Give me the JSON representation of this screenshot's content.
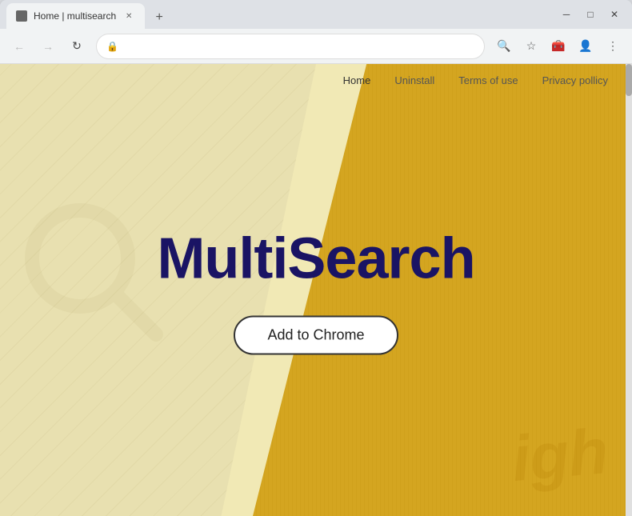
{
  "browser": {
    "tab": {
      "title": "Home | multisearch",
      "favicon": "🔍"
    },
    "new_tab_label": "+",
    "window_controls": {
      "minimize": "─",
      "maximize": "□",
      "close": "✕"
    },
    "address_bar": {
      "url": "",
      "lock_icon": "🔒"
    }
  },
  "site": {
    "nav": {
      "items": [
        {
          "label": "Home",
          "active": true
        },
        {
          "label": "Uninstall",
          "active": false
        },
        {
          "label": "Terms of use",
          "active": false
        },
        {
          "label": "Privacy pollicy",
          "active": false
        }
      ]
    },
    "hero": {
      "brand": "MultiSearch",
      "cta_button": "Add to Chrome"
    },
    "watermark_right": "igh"
  },
  "colors": {
    "brand_dark_blue": "#1a1464",
    "left_bg": "#e8e0b0",
    "right_bg": "#d4a520",
    "cta_bg": "#ffffff",
    "cta_border": "#333333"
  }
}
